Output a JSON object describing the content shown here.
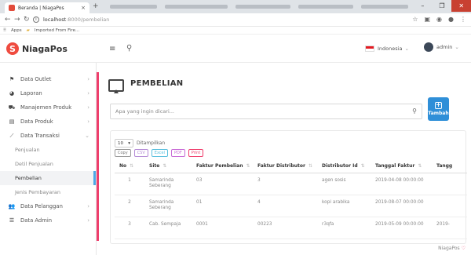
{
  "browser": {
    "tab_title": "Beranda | NiagaPos",
    "tab_close": "×",
    "new_tab": "+",
    "url_host": "localhost",
    "url_path": ":8000/pembelian",
    "bookmarks": [
      "Apps",
      "Imported From Fire..."
    ],
    "window_controls": [
      "–",
      "❐",
      "✕"
    ]
  },
  "header": {
    "logo_mark": "S",
    "app_name": "NiagaPos",
    "language": "Indonesia",
    "user": "admin"
  },
  "sidebar": {
    "items": [
      {
        "label": "Data Outlet",
        "icon": "flag-icon"
      },
      {
        "label": "Laporan",
        "icon": "chart-pie-icon"
      },
      {
        "label": "Manajemen Produk",
        "icon": "cart-icon"
      },
      {
        "label": "Data Produk",
        "icon": "box-icon"
      },
      {
        "label": "Data Transaksi",
        "icon": "line-chart-icon"
      }
    ],
    "subitems": [
      "Penjualan",
      "Detil Penjualan",
      "Pembelian",
      "Jenis Pembayaran"
    ],
    "items2": [
      {
        "label": "Data Pelanggan",
        "icon": "users-icon"
      },
      {
        "label": "Data Admin",
        "icon": "list-icon"
      }
    ]
  },
  "page": {
    "title": "PEMBELIAN",
    "search_placeholder": "Apa yang ingin dicari...",
    "add_label": "Tambah",
    "length_value": "10",
    "length_label": "Ditampilkan",
    "export_buttons": [
      "Copy",
      "CSV",
      "Excel",
      "PDF",
      "Print"
    ],
    "columns": [
      "No",
      "Site",
      "Faktur Pembelian",
      "Faktur Distributor",
      "Distributor Id",
      "Tanggal Faktur",
      "Tangg"
    ],
    "rows": [
      [
        "1",
        "Samarinda Seberang",
        "03",
        "3",
        "agen sosis",
        "2019-04-08 00:00:00",
        ""
      ],
      [
        "2",
        "Samarinda Seberang",
        "01",
        "4",
        "kopi arabika",
        "2019-08-07 00:00:00",
        ""
      ],
      [
        "3",
        "Cab. Sempaja",
        "0001",
        "00223",
        "r3qfa",
        "2019-05-09 00:00:00",
        "2019-"
      ]
    ],
    "footer": "NiagaPos",
    "footer_heart": "♡"
  },
  "colors": {
    "accent": "#ef3e6c",
    "primary_button": "#2f8fd8",
    "active_indicator": "#4ea8e6"
  }
}
